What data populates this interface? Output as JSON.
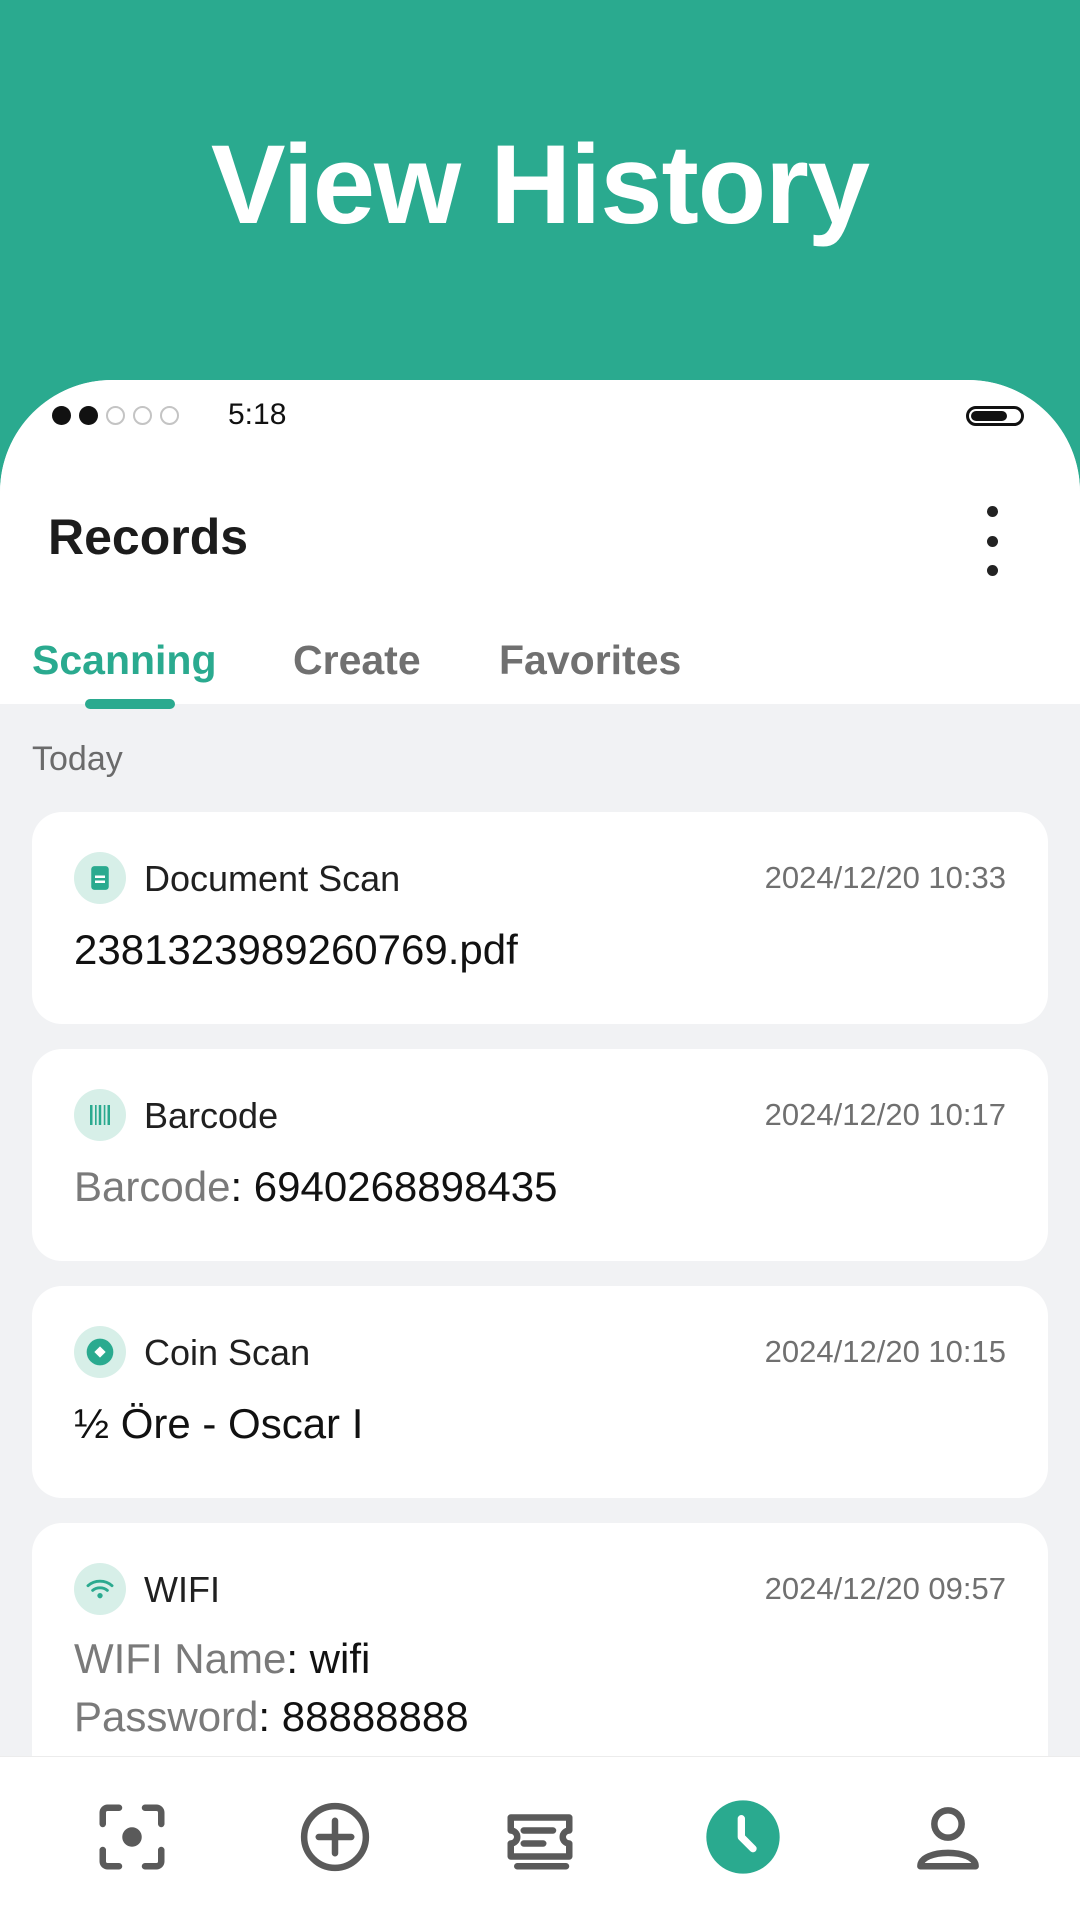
{
  "hero": {
    "title": "View History"
  },
  "status_bar": {
    "time": "5:18",
    "signal_bars_filled": 2,
    "signal_bars_total": 5
  },
  "header": {
    "title": "Records",
    "more_icon": "more-vertical-icon"
  },
  "tabs": [
    {
      "label": "Scanning",
      "active": true
    },
    {
      "label": "Create",
      "active": false
    },
    {
      "label": "Favorites",
      "active": false
    }
  ],
  "section": {
    "label": "Today"
  },
  "records": [
    {
      "icon": "document-icon",
      "type": "Document Scan",
      "time": "2024/12/20 10:33",
      "value": "2381323989260769.pdf"
    },
    {
      "icon": "barcode-icon",
      "type": "Barcode",
      "time": "2024/12/20 10:17",
      "field_label": "Barcode",
      "field_value": ": 6940268898435"
    },
    {
      "icon": "coin-icon",
      "type": "Coin Scan",
      "time": "2024/12/20 10:15",
      "value": "½ Öre - Oscar I"
    },
    {
      "icon": "wifi-icon",
      "type": "WIFI",
      "time": "2024/12/20 09:57",
      "name_label": "WIFI Name",
      "name_value": ": wifi",
      "password_label": "Password",
      "password_value": ": 88888888"
    }
  ],
  "bottom_nav": [
    {
      "icon": "scan-icon",
      "active": false
    },
    {
      "icon": "add-circle-icon",
      "active": false
    },
    {
      "icon": "ticket-icon",
      "active": false
    },
    {
      "icon": "history-clock-icon",
      "active": true
    },
    {
      "icon": "profile-icon",
      "active": false
    }
  ],
  "colors": {
    "accent": "#2aaa8f",
    "icon_bg": "#d7efe8",
    "background": "#f1f2f4",
    "text": "#111111",
    "muted_text": "#7a7a7a",
    "nav_icon": "#5a5a5a"
  }
}
